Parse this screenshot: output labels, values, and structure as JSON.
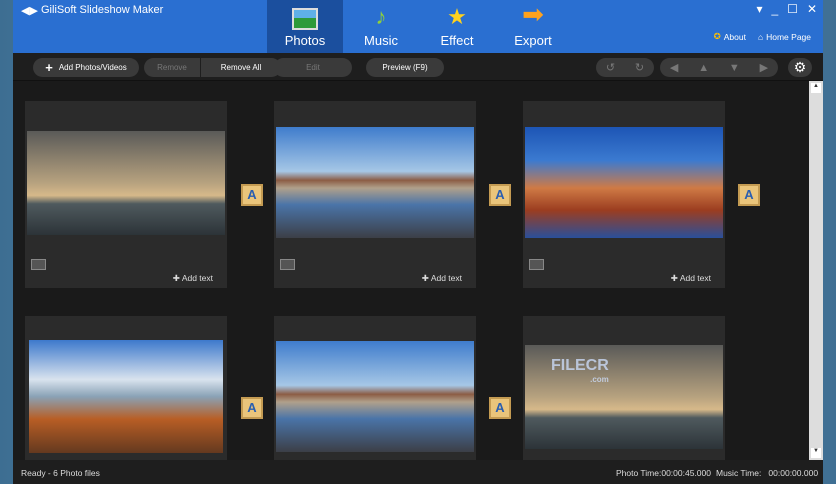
{
  "app": {
    "title": "GiliSoft Slideshow Maker"
  },
  "tabs": [
    {
      "label": "Photos",
      "icon": "photo-icon"
    },
    {
      "label": "Music",
      "icon": "music-note-icon"
    },
    {
      "label": "Effect",
      "icon": "magic-wand-icon"
    },
    {
      "label": "Export",
      "icon": "arrow-right-icon"
    }
  ],
  "links": {
    "about": "About",
    "home": "Home Page"
  },
  "toolbar": {
    "add": "Add Photos/Videos",
    "remove": "Remove",
    "remove_all": "Remove All",
    "edit": "Edit",
    "preview": "Preview (F9)"
  },
  "cards": [
    {
      "add_text": "Add text"
    },
    {
      "add_text": "Add text"
    },
    {
      "add_text": "Add text"
    }
  ],
  "watermark": {
    "text": "FILECR",
    "sub": ".com"
  },
  "status": {
    "left": "Ready - 6 Photo files",
    "photo_time": "Photo Time:00:00:45.000",
    "music_time": "Music Time:   00:00:00.000"
  },
  "colors": {
    "header": "#2a6fd1",
    "active_tab": "#1b4f9e"
  }
}
